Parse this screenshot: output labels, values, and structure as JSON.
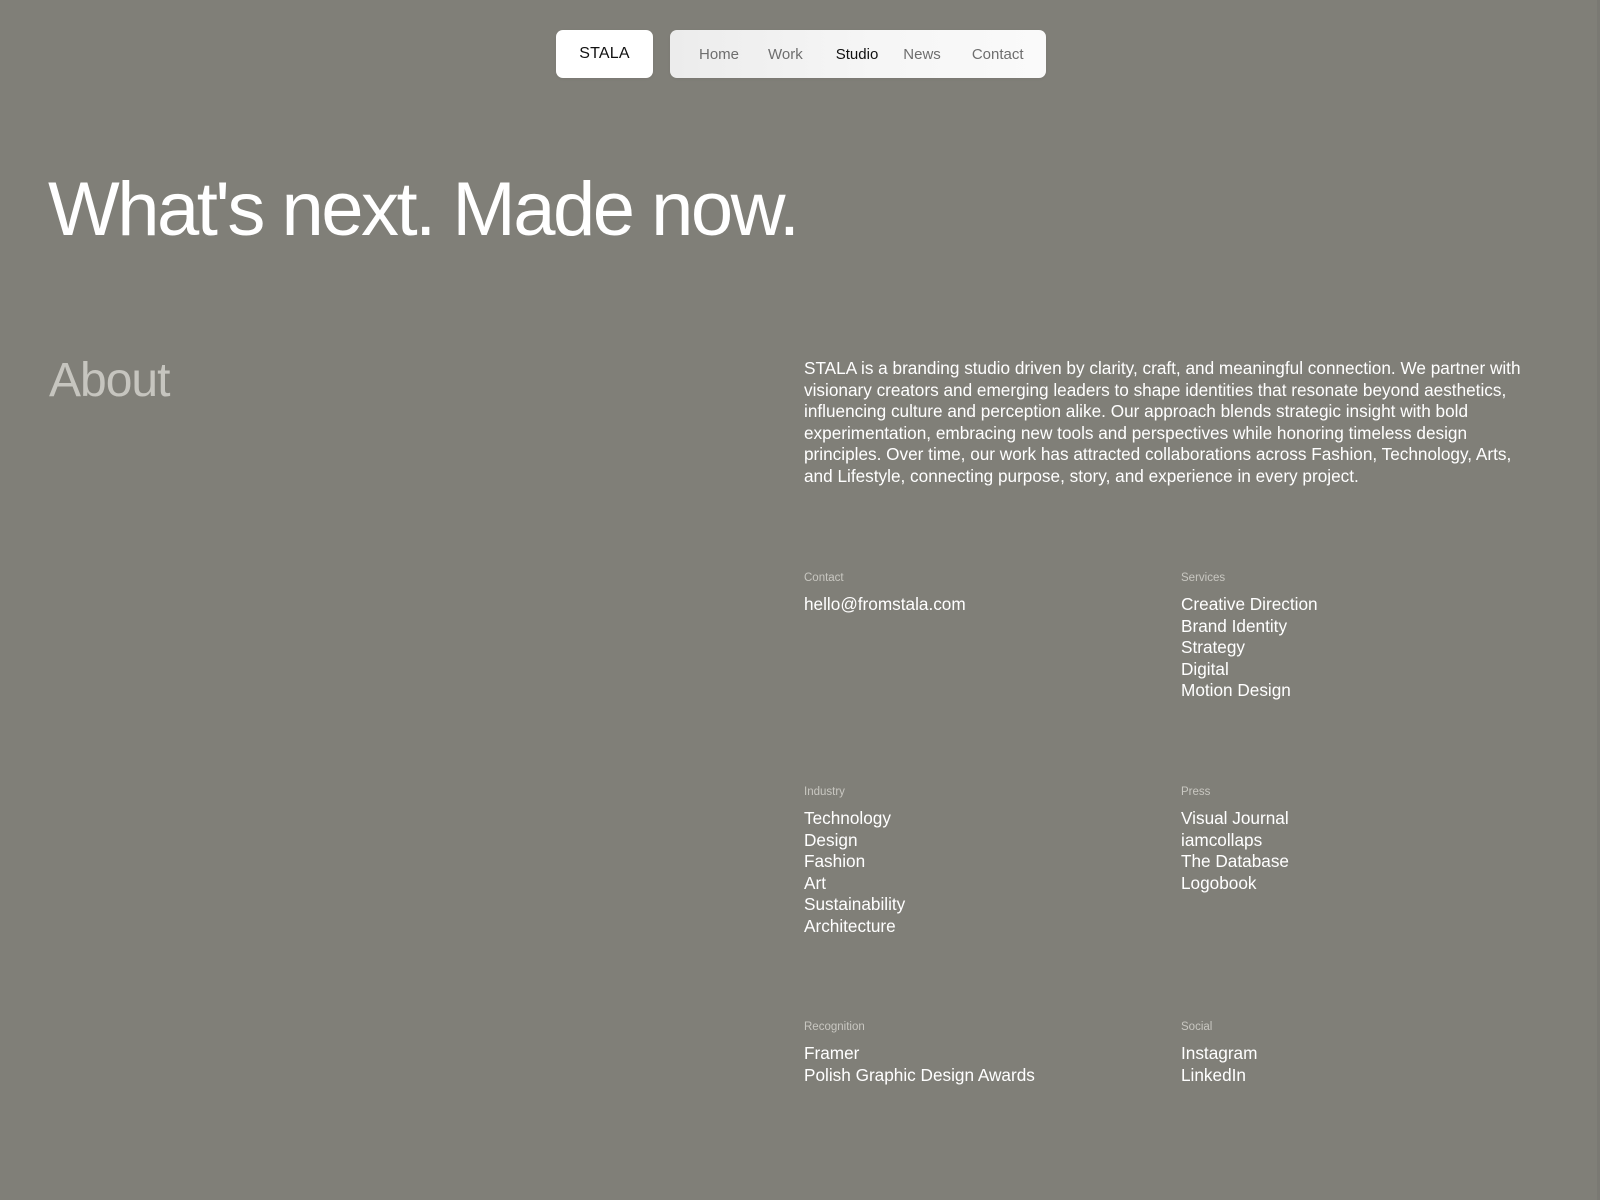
{
  "header": {
    "logo": "STALA",
    "nav": [
      {
        "label": "Home"
      },
      {
        "label": "Work"
      },
      {
        "label": "Studio"
      },
      {
        "label": "News"
      },
      {
        "label": "Contact"
      }
    ],
    "active_nav": "Studio"
  },
  "hero": {
    "title": "What's next. Made now."
  },
  "about": {
    "heading": "About",
    "text": "STALA is a branding studio driven by clarity, craft, and meaningful connection. We partner with visionary creators and emerging leaders to shape identities that resonate beyond aesthetics, influencing culture and perception alike. Our approach blends strategic insight with bold experimentation, embracing new tools and perspectives while honoring timeless design principles. Over time, our work has attracted collaborations across Fashion, Technology, Arts, and Lifestyle, connecting purpose, story, and experience in every project."
  },
  "info": {
    "contact": {
      "label": "Contact",
      "items": [
        "hello@fromstala.com"
      ]
    },
    "services": {
      "label": "Services",
      "items": [
        "Creative Direction",
        "Brand Identity",
        "Strategy",
        "Digital",
        "Motion Design"
      ]
    },
    "industry": {
      "label": "Industry",
      "items": [
        "Technology",
        "Design",
        "Fashion",
        "Art",
        "Sustainability",
        "Architecture"
      ]
    },
    "press": {
      "label": "Press",
      "items": [
        "Visual Journal",
        "iamcollaps",
        "The Database",
        "Logobook"
      ]
    },
    "recognition": {
      "label": "Recognition",
      "items": [
        "Framer",
        "Polish Graphic Design Awards"
      ]
    },
    "social": {
      "label": "Social",
      "items": [
        "Instagram",
        "LinkedIn"
      ]
    }
  },
  "colors": {
    "background": "#807f78",
    "text": "#ffffff",
    "muted_heading": "#c6c5bf",
    "label": "#c8c7c1",
    "nav_active": "#111111",
    "nav_inactive": "#6e6e6e"
  }
}
